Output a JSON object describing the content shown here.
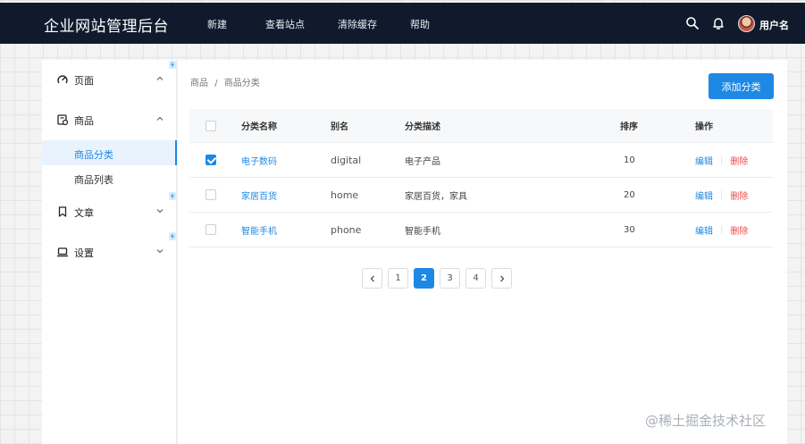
{
  "app": {
    "title": "企业网站管理后台",
    "nav": [
      "新建",
      "查看站点",
      "清除缓存",
      "帮助"
    ],
    "username": "用户名"
  },
  "sidebar": {
    "menus": [
      {
        "label": "页面",
        "icon": "speedometer-icon",
        "expanded": true
      },
      {
        "label": "商品",
        "icon": "receipt-icon",
        "expanded": true
      },
      {
        "label": "文章",
        "icon": "bookmark-icon",
        "expanded": false
      },
      {
        "label": "设置",
        "icon": "laptop-icon",
        "expanded": false
      }
    ],
    "submenu": [
      {
        "label": "商品分类",
        "active": true
      },
      {
        "label": "商品列表",
        "active": false
      }
    ]
  },
  "breadcrumb": [
    "商品",
    "/",
    "商品分类"
  ],
  "add_button": "添加分类",
  "table": {
    "headers": [
      "分类名称",
      "别名",
      "分类描述",
      "排序",
      "操作"
    ],
    "rows": [
      {
        "checked": true,
        "name": "电子数码",
        "alias": "digital",
        "desc": "电子产品",
        "order": "10",
        "edit": "编辑",
        "delete": "删除"
      },
      {
        "checked": false,
        "name": "家居百货",
        "alias": "home",
        "desc": "家居百货，家具",
        "order": "20",
        "edit": "编辑",
        "delete": "删除"
      },
      {
        "checked": false,
        "name": "智能手机",
        "alias": "phone",
        "desc": "智能手机",
        "order": "30",
        "edit": "编辑",
        "delete": "删除"
      }
    ]
  },
  "pagination": {
    "pages": [
      "1",
      "2",
      "3",
      "4"
    ],
    "current": "2"
  },
  "watermark": "@稀土掘金技术社区",
  "colors": {
    "accent": "#1e88e5",
    "topbar": "#0f1b2d",
    "danger": "#f04848"
  }
}
